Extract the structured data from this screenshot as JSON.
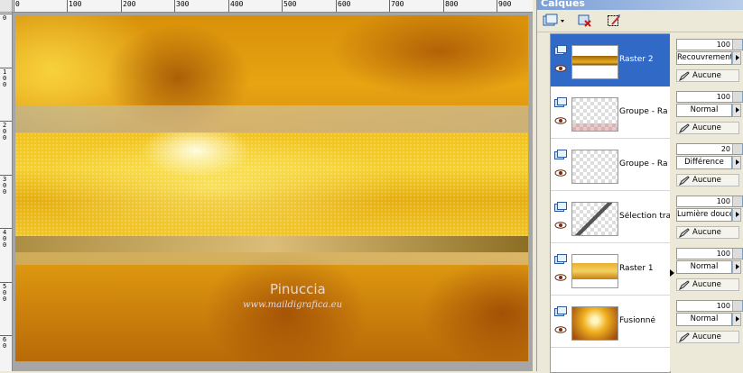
{
  "ruler": {
    "top_labels": [
      "0",
      "100",
      "200",
      "300",
      "400",
      "500",
      "600",
      "700",
      "800",
      "900"
    ],
    "left_labels": [
      "0",
      "1\n0\n0",
      "2\n0\n0",
      "3\n0\n0",
      "4\n0\n0",
      "5\n0\n0",
      "6\n0"
    ]
  },
  "canvas": {
    "watermark_title": "Pinuccia",
    "watermark_url": "www.maildigrafica.eu"
  },
  "palette": {
    "title": "Calques",
    "layers": [
      {
        "name": "Raster 2",
        "opacity": "100",
        "blend": "Recouvrement",
        "mask": "Aucune",
        "selected": true
      },
      {
        "name": "Groupe - Ra",
        "opacity": "100",
        "blend": "Normal",
        "mask": "Aucune",
        "selected": false
      },
      {
        "name": "Groupe - Ra",
        "opacity": "20",
        "blend": "Différence",
        "mask": "Aucune",
        "selected": false
      },
      {
        "name": "Sélection tra",
        "opacity": "100",
        "blend": "Lumière douce",
        "mask": "Aucune",
        "selected": false
      },
      {
        "name": "Raster 1",
        "opacity": "100",
        "blend": "Normal",
        "mask": "Aucune",
        "selected": false
      },
      {
        "name": "Fusionné",
        "opacity": "100",
        "blend": "Normal",
        "mask": "Aucune",
        "selected": false
      }
    ]
  }
}
